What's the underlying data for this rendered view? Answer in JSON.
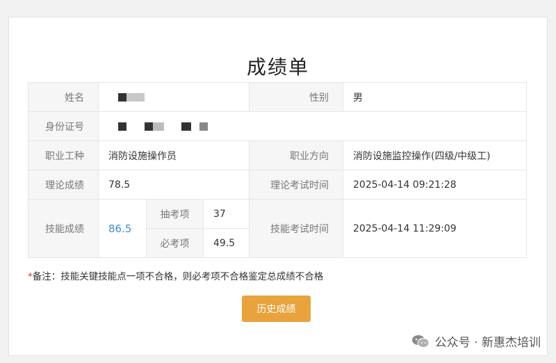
{
  "page_title": "成绩单",
  "info_table": {
    "name_label": "姓名",
    "gender_label": "性别",
    "gender_value": "男",
    "id_label": "身份证号",
    "job_label": "职业工种",
    "job_value": "消防设施操作员",
    "direction_label": "职业方向",
    "direction_value": "消防设施监控操作(四级/中级工)",
    "theory_score_label": "理论成绩",
    "theory_score_value": "78.5",
    "theory_time_label": "理论考试时间",
    "theory_time_value": "2025-04-14 09:21:28",
    "skill_score_label": "技能成绩",
    "skill_score_value": "86.5",
    "draw_item_label": "抽考项",
    "draw_item_value": "37",
    "required_item_label": "必考项",
    "required_item_value": "49.5",
    "skill_time_label": "技能考试时间",
    "skill_time_value": "2025-04-14 11:29:09"
  },
  "note": {
    "marker": "*",
    "text": "备注：技能关键技能点一项不合格，则必考项不合格鉴定总成绩不合格"
  },
  "history_button_label": "历史成绩",
  "watermark": {
    "text": "公众号 · 新惠杰培训",
    "icon": "wechat-icon"
  },
  "colors": {
    "button": "#e8a33c",
    "skill_score": "#3a8fd0",
    "note_marker": "#e03030"
  }
}
